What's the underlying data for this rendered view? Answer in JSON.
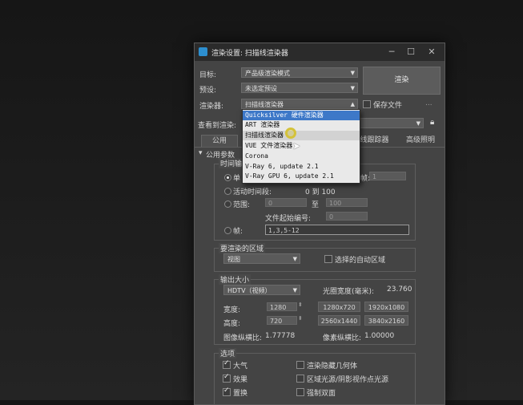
{
  "window": {
    "title": "渲染设置: 扫描线渲染器",
    "minimize": "─",
    "maximize": "☐",
    "close": "✕"
  },
  "top": {
    "target_label": "目标:",
    "target_value": "产品级渲染模式",
    "preset_label": "预设:",
    "preset_value": "未选定预设",
    "renderer_label": "渲染器:",
    "renderer_value": "扫描线渲染器",
    "render_button": "渲染",
    "save_file_label": "保存文件",
    "more_label": "...",
    "view_label": "查看到渲染:",
    "lock_icon": "lock-icon"
  },
  "tabs": [
    {
      "label": "公用"
    },
    {
      "label": "光线跟踪器"
    },
    {
      "label": "高级照明"
    }
  ],
  "rollout": {
    "title": "公用参数"
  },
  "time_output": {
    "title": "时间输",
    "single": "单",
    "frame_label": "帧:",
    "frame_value": "1",
    "active_segment": "活动时间段:",
    "active_range": "0 到 100",
    "range_label": "范围:",
    "range_from": "0",
    "range_to_label": "至",
    "range_to": "100",
    "file_start_label": "文件起始编号:",
    "file_start": "0",
    "frames_label": "帧:",
    "frames_value": "1,3,5-12"
  },
  "area": {
    "title": "要渲染的区域",
    "value": "视图",
    "auto_region": "选择的自动区域"
  },
  "output_size": {
    "title": "输出大小",
    "preset": "HDTV（视频）",
    "aperture_label": "光圈宽度(毫米):",
    "aperture_value": "23.760",
    "width_label": "宽度:",
    "width_value": "1280",
    "height_label": "高度:",
    "height_value": "720",
    "presets": [
      "1280x720",
      "1920x1080",
      "2560x1440",
      "3840x2160"
    ],
    "image_aspect_label": "图像纵横比:",
    "image_aspect_value": "1.77778",
    "pixel_aspect_label": "像素纵横比:",
    "pixel_aspect_value": "1.00000"
  },
  "options": {
    "title": "选项",
    "items": [
      {
        "label": "大气",
        "checked": true
      },
      {
        "label": "渲染隐藏几何体",
        "checked": false
      },
      {
        "label": "效果",
        "checked": true
      },
      {
        "label": "区域光源/阴影视作点光源",
        "checked": false
      },
      {
        "label": "置换",
        "checked": true
      },
      {
        "label": "强制双面",
        "checked": false
      }
    ]
  },
  "renderer_dropdown": {
    "items": [
      {
        "label": "Quicksilver 硬件渲染器",
        "state": "selected"
      },
      {
        "label": "ART 渲染器",
        "state": "normal"
      },
      {
        "label": "扫描线渲染器",
        "state": "hover"
      },
      {
        "label": "VUE 文件渲染器",
        "state": "normal"
      },
      {
        "label": "Corona",
        "state": "normal"
      },
      {
        "label": "V-Ray 6, update 2.1",
        "state": "normal"
      },
      {
        "label": "V-Ray GPU 6, update 2.1",
        "state": "normal"
      }
    ]
  },
  "colors": {
    "selection": "#3d78c8",
    "cursor_highlight": "#d4c23a"
  }
}
